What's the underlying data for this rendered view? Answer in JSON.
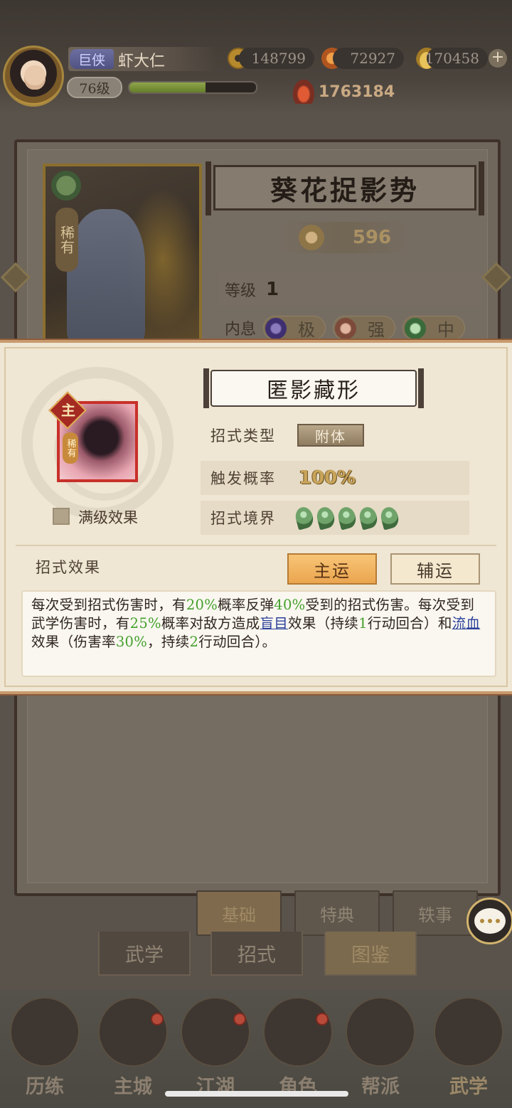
{
  "player": {
    "title_badge": "巨侠",
    "name": "虾大仁",
    "level": "76级",
    "xp_fraction": 0.6
  },
  "resources": {
    "copper": "148799",
    "flame": "72927",
    "ingot": "170458",
    "combat_power": "1763184"
  },
  "background_detail": {
    "skill_title": "葵花捉影势",
    "card_rarity": "稀有",
    "power": "596",
    "level_label": "等级",
    "level_value": "1",
    "inner_label": "内息",
    "inner_tags": [
      "极",
      "强",
      "中"
    ],
    "subtabs": [
      "基础",
      "特典",
      "轶事"
    ],
    "tabs": [
      "武学",
      "招式",
      "图鉴"
    ]
  },
  "popup": {
    "name": "匿影藏形",
    "icon_main_tag": "主",
    "icon_rarity": "稀有",
    "checkbox_label": "满级效果",
    "type_label": "招式类型",
    "type_value": "附体",
    "trigger_label": "触发概率",
    "trigger_value": "100%",
    "realm_label": "招式境界",
    "realm_level": 5,
    "effect_label": "招式效果",
    "btn_main": "主运",
    "btn_aux": "辅运",
    "desc": {
      "p1": "每次受到招式伤害时，有",
      "v1": "20%",
      "p2": "概率反弹",
      "v2": "40%",
      "p3": "受到的招式伤害。每次受到武学伤害时，有",
      "v3": "25%",
      "p4": "概率对敌方造成",
      "k1": "盲目",
      "p5": "效果（持续",
      "v4": "1",
      "p6": "行动回合）和",
      "k2": "流血",
      "p7": "效果（伤害率",
      "v5": "30%",
      "p8": "，持续",
      "v6": "2",
      "p9": "行动回合）。"
    }
  },
  "nav": {
    "items": [
      {
        "label": "历练",
        "badge": false
      },
      {
        "label": "主城",
        "badge": true
      },
      {
        "label": "江湖",
        "badge": true
      },
      {
        "label": "角色",
        "badge": true
      },
      {
        "label": "帮派",
        "badge": false
      },
      {
        "label": "武学",
        "badge": false
      }
    ],
    "active": "武学"
  }
}
